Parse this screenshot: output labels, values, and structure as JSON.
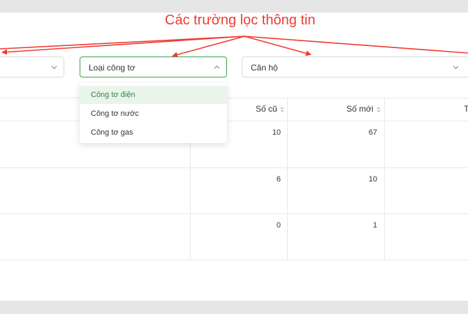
{
  "annotation": {
    "text": "Các trường lọc thông tin",
    "color": "#ee3b32"
  },
  "filters": [
    {
      "value": "",
      "icon": "chevron-down-icon"
    },
    {
      "value": "Loại công tơ",
      "icon": "chevron-up-icon",
      "open": true
    },
    {
      "value": "Căn hộ",
      "icon": "chevron-down-icon"
    }
  ],
  "dropdown": {
    "options": [
      "Công tơ điện",
      "Công tơ nước",
      "Công tơ gas"
    ],
    "selected": "Công tơ điện"
  },
  "table": {
    "headers": [
      "Số cũ",
      "Số mới",
      "T"
    ],
    "rows": [
      {
        "old": "10",
        "new": "67"
      },
      {
        "old": "6",
        "new": "10"
      },
      {
        "old": "0",
        "new": "1"
      }
    ]
  },
  "colors": {
    "accent": "#3d9d4a",
    "selected_bg": "#e9f4ea",
    "annotation": "#ee3b32"
  }
}
